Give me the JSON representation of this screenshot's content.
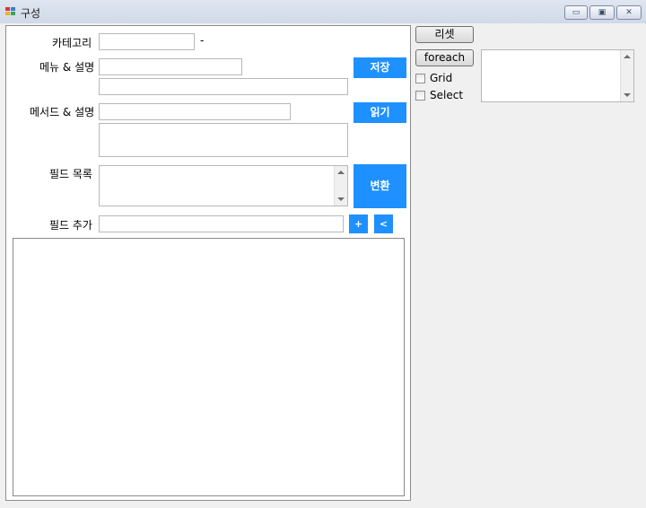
{
  "window": {
    "title": "구성",
    "minimize_glyph": "▭",
    "maximize_glyph": "▣",
    "close_glyph": "✕"
  },
  "form": {
    "category_label": "카테고리",
    "category_dash": "-",
    "menu_label": "메뉴 & 설명",
    "method_label": "메서드 & 설명",
    "fields_label": "필드 목록",
    "field_add_label": "필드 추가"
  },
  "buttons": {
    "save": "저장",
    "read": "읽기",
    "convert": "변환",
    "add": "+",
    "back": "<",
    "reset": "리셋",
    "foreach": "foreach"
  },
  "checkboxes": {
    "grid": "Grid",
    "select": "Select"
  },
  "colors": {
    "accent": "#1e90ff"
  }
}
